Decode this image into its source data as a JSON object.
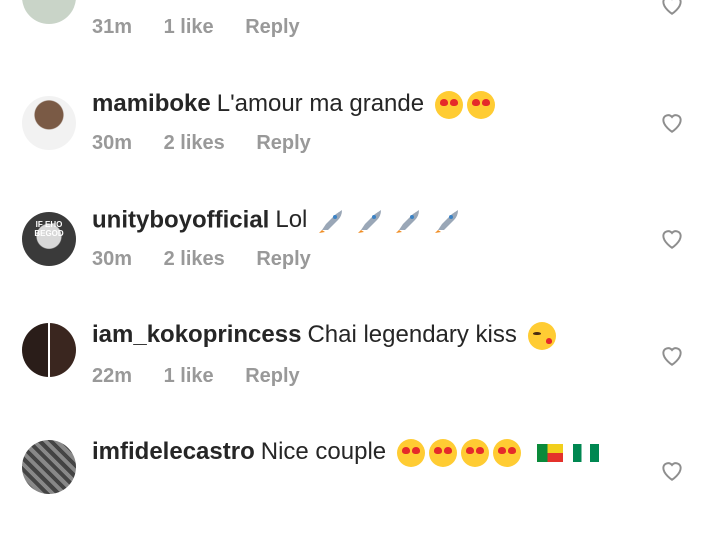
{
  "comments": [
    {
      "username": "",
      "text": "",
      "time": "31m",
      "likes": "1 like",
      "reply": "Reply"
    },
    {
      "username": "mamiboke",
      "text": "L'amour  ma grande",
      "time": "30m",
      "likes": "2 likes",
      "reply": "Reply"
    },
    {
      "username": "unityboyofficial",
      "text": "Lol",
      "time": "30m",
      "likes": "2 likes",
      "reply": "Reply"
    },
    {
      "username": "iam_kokoprincess",
      "text": "Chai legendary kiss",
      "time": "22m",
      "likes": "1 like",
      "reply": "Reply"
    },
    {
      "username": "imfidelecastro",
      "text": "Nice couple",
      "time": "",
      "likes": "",
      "reply": ""
    }
  ],
  "avatar_labels": {
    "unityboy": "IF EHO BEGOD"
  }
}
